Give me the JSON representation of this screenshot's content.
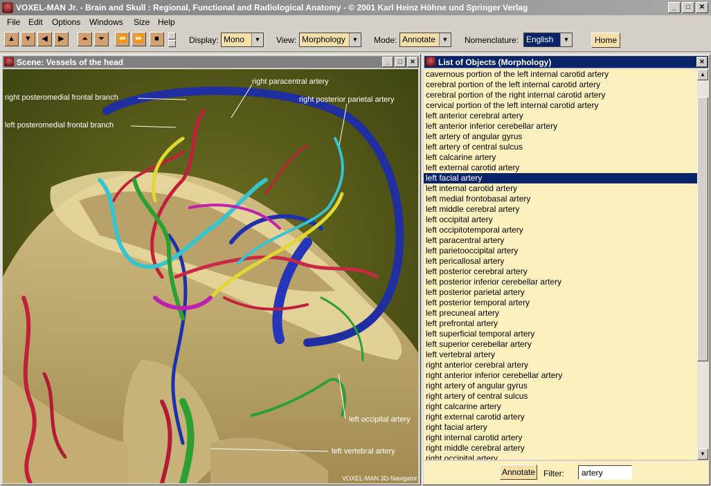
{
  "window": {
    "title": "VOXEL-MAN Jr. - Brain and Skull : Regional, Functional and Radiological Anatomy - © 2001 Karl Heinz Höhne und Springer Verlag",
    "min": "_",
    "max": "□",
    "close": "✕"
  },
  "menu": [
    "File",
    "Edit",
    "Options",
    "Windows",
    "Size",
    "Help"
  ],
  "toolbar": {
    "nav_buttons": [
      "▲",
      "▼",
      "◀",
      "▶",
      "⏶",
      "⏷",
      "⏪",
      "⏩",
      "■"
    ],
    "display_label": "Display:",
    "display_value": "Mono",
    "view_label": "View:",
    "view_value": "Morphology",
    "mode_label": "Mode:",
    "mode_value": "Annotate",
    "nomenclature_label": "Nomenclature:",
    "nomenclature_value": "English",
    "home_label": "Home"
  },
  "scene_panel": {
    "title": "Scene: Vessels of the head",
    "watermark": "VOXEL-MAN 3D-Navigator",
    "labels": [
      "right posteromedial frontal branch",
      "left posteromedial frontal branch",
      "right paracentral artery",
      "right posterior parietal artery",
      "left occipital artery",
      "left vertebral artery"
    ],
    "colors": {
      "background": "#5a5e18",
      "bone": "#c9b277",
      "artery_red": "#c0203a",
      "artery_blue": "#1f2fa0",
      "artery_cyan": "#35c4d0",
      "artery_green": "#2aa030",
      "artery_yellow": "#e0d830",
      "artery_magenta": "#c020b0"
    }
  },
  "list_panel": {
    "title": "List of Objects (Morphology)",
    "items": [
      "cavernous portion of the left internal carotid artery",
      "cerebral portion of the left internal carotid artery",
      "cerebral portion of the right internal carotid artery",
      "cervical portion of the left internal carotid artery",
      "left anterior cerebral artery",
      "left anterior inferior cerebellar artery",
      "left artery of angular gyrus",
      "left artery of central sulcus",
      "left calcarine artery",
      "left external carotid artery",
      "left facial artery",
      "left internal carotid artery",
      "left medial frontobasal artery",
      "left middle cerebral artery",
      "left occipital artery",
      "left occipitotemporal artery",
      "left paracentral artery",
      "left parietooccipital artery",
      "left pericallosal artery",
      "left posterior cerebral artery",
      "left posterior inferior cerebellar artery",
      "left posterior parietal artery",
      "left posterior temporal artery",
      "left precuneal artery",
      "left prefrontal artery",
      "left superficial temporal artery",
      "left superior cerebellar artery",
      "left vertebral artery",
      "right anterior cerebral artery",
      "right anterior inferior cerebellar artery",
      "right artery of angular gyrus",
      "right artery of central sulcus",
      "right calcarine artery",
      "right external carotid artery",
      "right facial artery",
      "right internal carotid artery",
      "right middle cerebral artery",
      "right occipital artery"
    ],
    "selected_item": "left facial artery",
    "annotate_button": "Annotate",
    "filter_label": "Filter:",
    "filter_value": "artery"
  }
}
